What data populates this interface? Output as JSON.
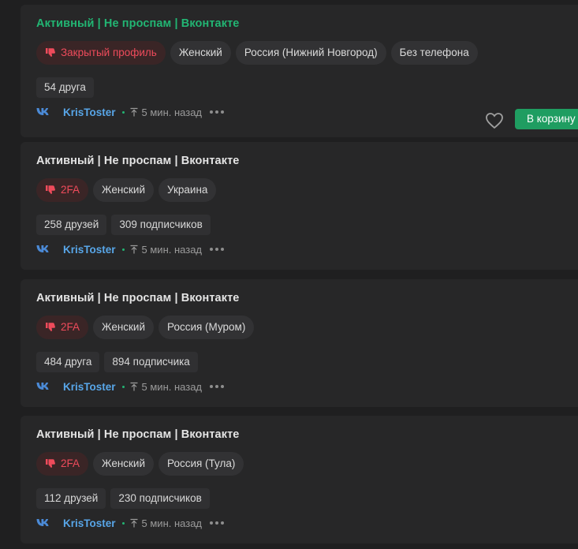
{
  "colors": {
    "accent_green": "#22b573",
    "danger_red": "#ee4b5b",
    "link_blue": "#58a6e8",
    "card_bg": "#272728",
    "page_bg": "#1f1f20"
  },
  "listings": [
    {
      "title": "Активный | Не проспам | Вконтакте",
      "title_highlighted": true,
      "warning_tag": "Закрытый профиль",
      "tags": [
        "Женский",
        "Россия (Нижний Новгород)",
        "Без телефона"
      ],
      "stats": [
        "54 друга"
      ],
      "seller": "KrisToster",
      "time": "5 мин. назад",
      "cart_label": "В корзину"
    },
    {
      "title": "Активный | Не проспам | Вконтакте",
      "title_highlighted": false,
      "warning_tag": "2FA",
      "tags": [
        "Женский",
        "Украина"
      ],
      "stats": [
        "258 друзей",
        "309 подписчиков"
      ],
      "seller": "KrisToster",
      "time": "5 мин. назад"
    },
    {
      "title": "Активный | Не проспам | Вконтакте",
      "title_highlighted": false,
      "warning_tag": "2FA",
      "tags": [
        "Женский",
        "Россия (Муром)"
      ],
      "stats": [
        "484 друга",
        "894 подписчика"
      ],
      "seller": "KrisToster",
      "time": "5 мин. назад"
    },
    {
      "title": "Активный | Не проспам | Вконтакте",
      "title_highlighted": false,
      "warning_tag": "2FA",
      "tags": [
        "Женский",
        "Россия (Тула)"
      ],
      "stats": [
        "112 друзей",
        "230 подписчиков"
      ],
      "seller": "KrisToster",
      "time": "5 мин. назад"
    }
  ],
  "icons": {
    "warning": "thumbs-down-icon",
    "platform": "vk-logo-icon",
    "time": "arrow-up-icon",
    "menu": "more-dots-icon",
    "favorite": "heart-icon"
  }
}
